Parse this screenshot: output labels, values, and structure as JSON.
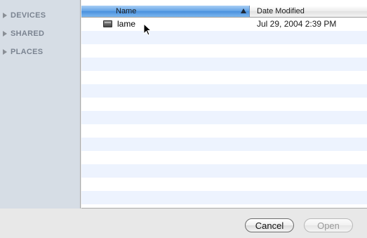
{
  "sidebar": {
    "sections": [
      {
        "label": "DEVICES"
      },
      {
        "label": "SHARED"
      },
      {
        "label": "PLACES"
      }
    ]
  },
  "file_list": {
    "columns": {
      "name": "Name",
      "date_modified": "Date Modified",
      "sort_column": "Name",
      "sort_direction": "ascending"
    },
    "rows": [
      {
        "name": "lame",
        "date_modified": "Jul 29, 2004 2:39 PM",
        "icon": "unix-executable-icon"
      }
    ]
  },
  "buttons": {
    "cancel": "Cancel",
    "open": "Open",
    "open_enabled": false
  },
  "colors": {
    "selected_header": "#5fa1e6",
    "row_alt": "#edf3fe",
    "sidebar_bg": "#d6dde5"
  }
}
